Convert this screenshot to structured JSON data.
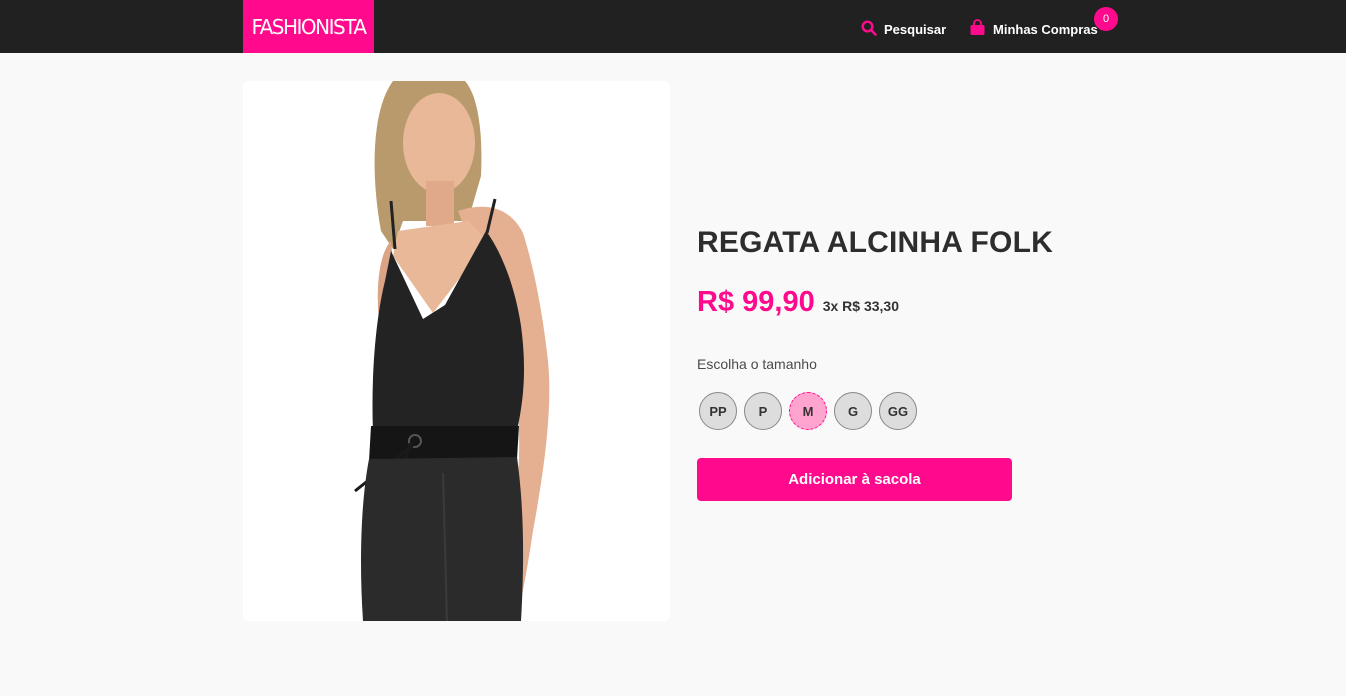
{
  "header": {
    "logo_text": "FASHIONISTA",
    "search_label": "Pesquisar",
    "cart_label": "Minhas Compras",
    "cart_count": "0",
    "accent_color": "#ff0a8c",
    "bar_color": "#212121"
  },
  "product": {
    "image_alt": "Modelo vestindo regata alcinha preta",
    "title": "REGATA ALCINHA FOLK",
    "price": "R$ 99,90",
    "installments": "3x R$ 33,30",
    "size_prompt": "Escolha o tamanho",
    "sizes": [
      "PP",
      "P",
      "M",
      "G",
      "GG"
    ],
    "selected_size": "M",
    "add_to_bag_label": "Adicionar à sacola"
  },
  "icons": {
    "search": "search-icon",
    "cart": "shopping-bag-icon"
  }
}
